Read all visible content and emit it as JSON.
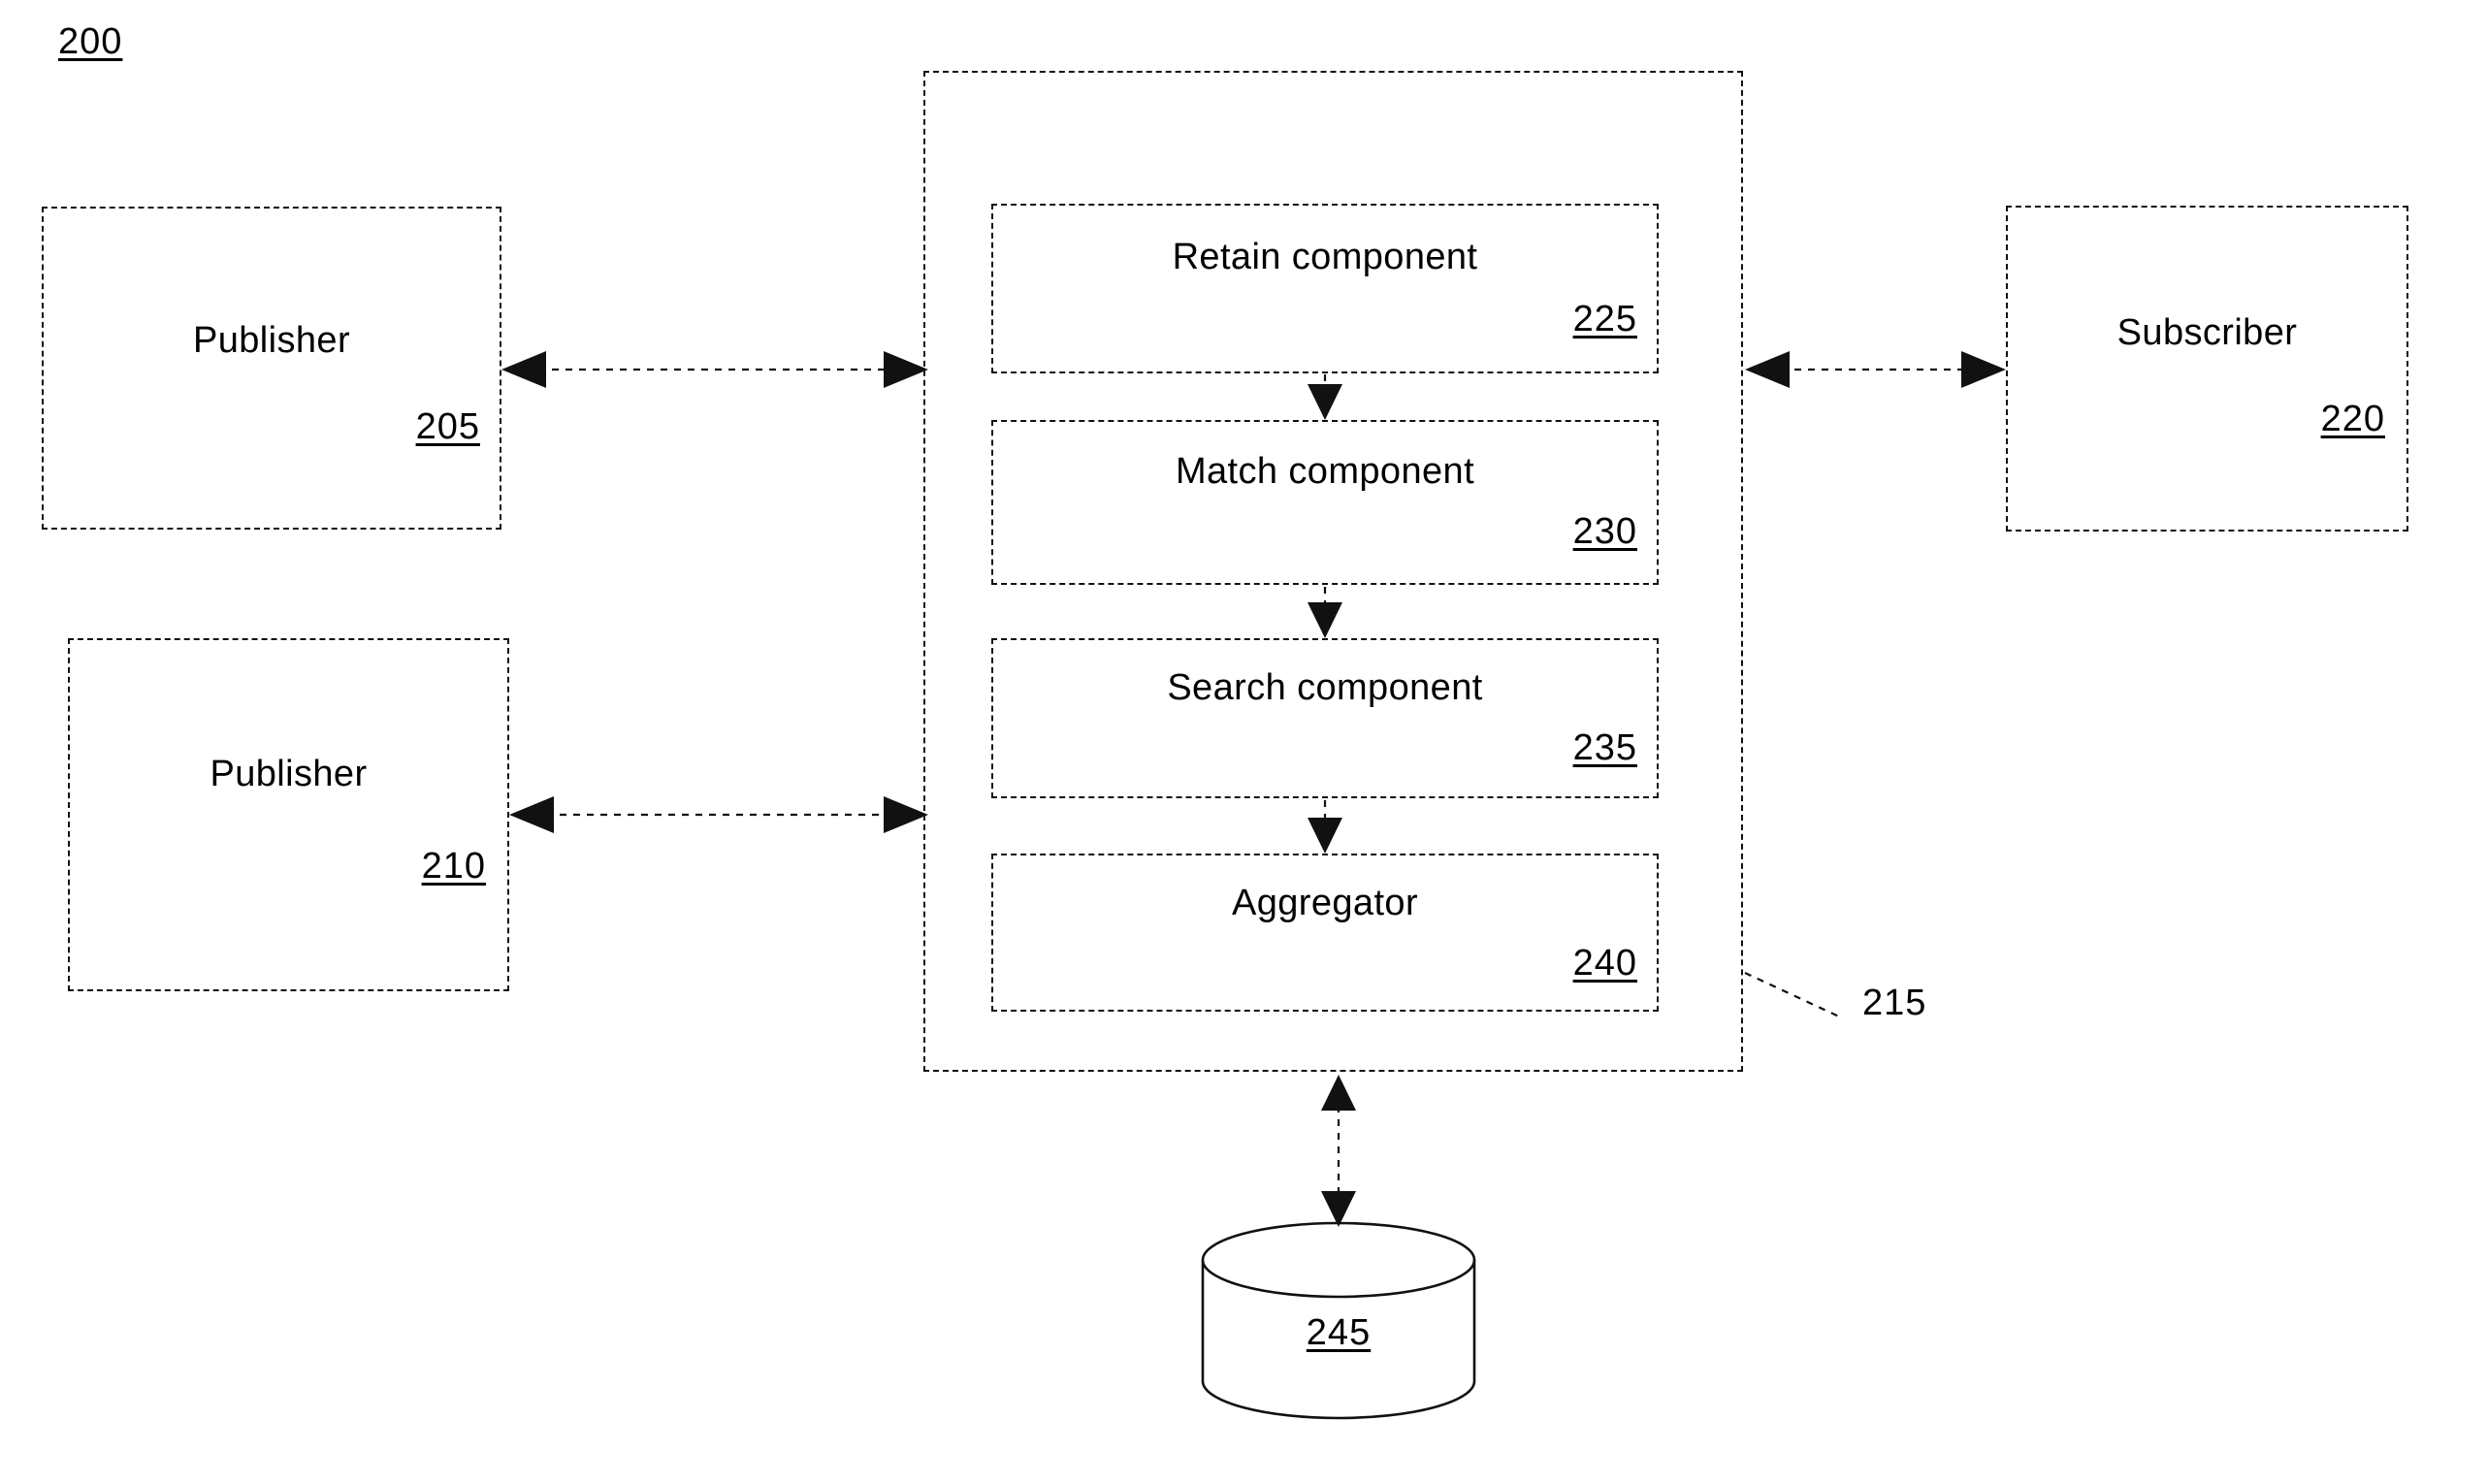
{
  "figure": {
    "number": "200"
  },
  "nodes": {
    "publisher_a": {
      "title": "Publisher",
      "ref": "205"
    },
    "publisher_b": {
      "title": "Publisher",
      "ref": "210"
    },
    "subscriber": {
      "title": "Subscriber",
      "ref": "220"
    },
    "system_container": {
      "ref": "215"
    },
    "retain_component": {
      "title": "Retain component",
      "ref": "225"
    },
    "match_component": {
      "title": "Match component",
      "ref": "230"
    },
    "search_component": {
      "title": "Search component",
      "ref": "235"
    },
    "aggregator": {
      "title": "Aggregator",
      "ref": "240"
    },
    "database": {
      "ref": "245"
    }
  },
  "colors": {
    "stroke": "#111111",
    "background": "#ffffff"
  }
}
